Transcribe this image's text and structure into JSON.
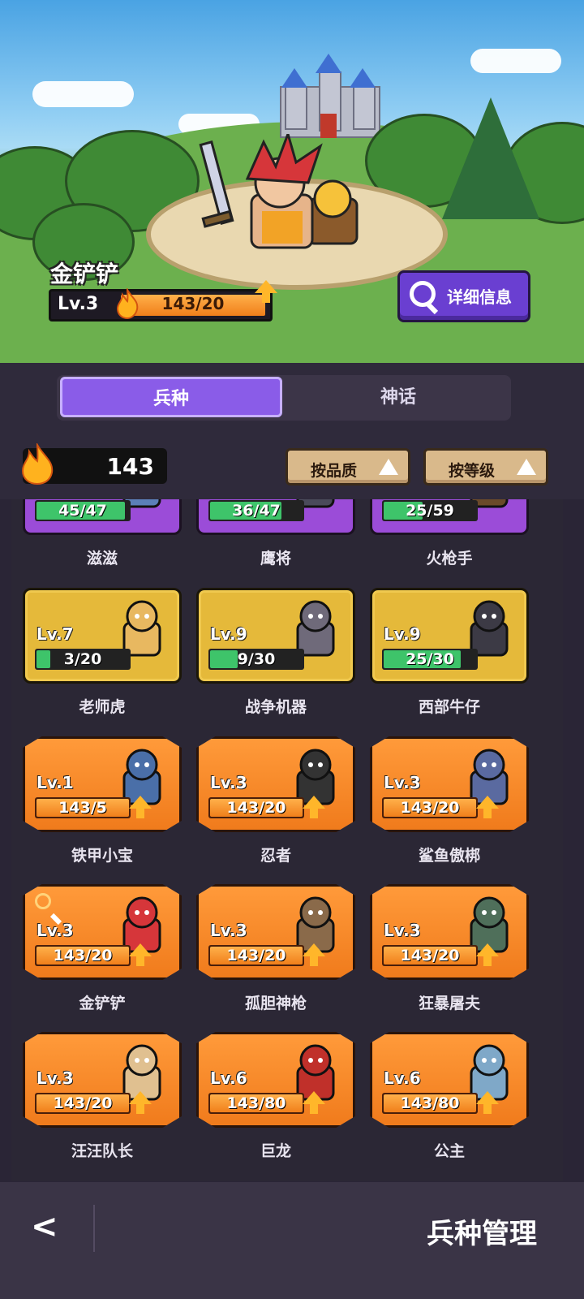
{
  "hero": {
    "name": "金铲铲",
    "level": "Lv.3",
    "progress": "143/20",
    "detail_button": "详细信息"
  },
  "tabs": [
    {
      "label": "兵种",
      "active": true
    },
    {
      "label": "神话",
      "active": false
    }
  ],
  "currency": {
    "value": "143",
    "icon": "flame-icon"
  },
  "sort": {
    "by_quality": "按品质",
    "by_level": "按等级"
  },
  "units": [
    {
      "name": "滋滋",
      "tier": "purple",
      "level": "",
      "progress": "45/47",
      "fill": 0.96
    },
    {
      "name": "鹰将",
      "tier": "purple",
      "level": "",
      "progress": "36/47",
      "fill": 0.77
    },
    {
      "name": "火枪手",
      "tier": "purple",
      "level": "",
      "progress": "25/59",
      "fill": 0.42
    },
    {
      "name": "老师虎",
      "tier": "gold",
      "level": "Lv.7",
      "progress": "3/20",
      "fill": 0.15
    },
    {
      "name": "战争机器",
      "tier": "gold",
      "level": "Lv.9",
      "progress": "9/30",
      "fill": 0.3
    },
    {
      "name": "西部牛仔",
      "tier": "gold",
      "level": "Lv.9",
      "progress": "25/30",
      "fill": 0.83
    },
    {
      "name": "铁甲小宝",
      "tier": "orange",
      "level": "Lv.1",
      "progress": "143/5",
      "fill": 1
    },
    {
      "name": "忍者",
      "tier": "orange",
      "level": "Lv.3",
      "progress": "143/20",
      "fill": 1
    },
    {
      "name": "鲨鱼傲梆",
      "tier": "orange",
      "level": "Lv.3",
      "progress": "143/20",
      "fill": 1
    },
    {
      "name": "金铲铲",
      "tier": "orange",
      "level": "Lv.3",
      "progress": "143/20",
      "fill": 1,
      "selected": true
    },
    {
      "name": "孤胆神枪",
      "tier": "orange",
      "level": "Lv.3",
      "progress": "143/20",
      "fill": 1
    },
    {
      "name": "狂暴屠夫",
      "tier": "orange",
      "level": "Lv.3",
      "progress": "143/20",
      "fill": 1
    },
    {
      "name": "汪汪队长",
      "tier": "orange",
      "level": "Lv.3",
      "progress": "143/20",
      "fill": 1
    },
    {
      "name": "巨龙",
      "tier": "orange",
      "level": "Lv.6",
      "progress": "143/80",
      "fill": 1
    },
    {
      "name": "公主",
      "tier": "orange",
      "level": "Lv.6",
      "progress": "143/80",
      "fill": 1
    }
  ],
  "footer": {
    "back": "<",
    "title": "兵种管理"
  },
  "colors": {
    "accent": "#8a5ce8",
    "gold_card": "#e5b93a",
    "orange_card": "#f07b1c",
    "purple_card": "#9b4cd8",
    "progress_green": "#3ec46a"
  }
}
